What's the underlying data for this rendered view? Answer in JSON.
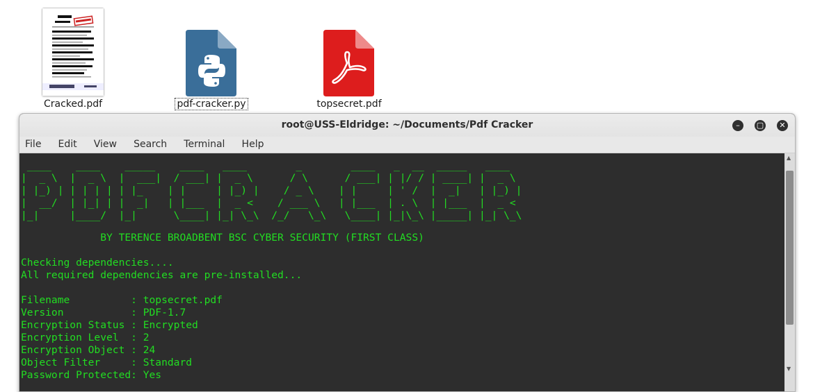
{
  "desktop": {
    "icons": [
      {
        "label": "Cracked.pdf"
      },
      {
        "label": "pdf-cracker.py"
      },
      {
        "label": "topsecret.pdf"
      }
    ]
  },
  "colors": {
    "terminal_bg": "#2d2d2d",
    "terminal_text": "#22dd22",
    "python_file": "#3a6e99",
    "pdf_file": "#dd1d1d"
  },
  "terminal": {
    "title": "root@USS-Eldridge: ~/Documents/Pdf Cracker",
    "menu": [
      "File",
      "Edit",
      "View",
      "Search",
      "Terminal",
      "Help"
    ],
    "banner_lines": [
      " ____    ____    _____    ____   ____        _        ____   _  __  _____   ____",
      "|  _ \\  |  _ \\  |  ___|  / ___| |  _ \\      / \\      / ___| | |/ / | ____| |  _ \\",
      "| |_) | | | | | | |_    | |     | |_) |    / _ \\    | |     | ' /  |  _|   | |_) |",
      "|  __/  | |_| | |  _|   | |___  |  _ <    / ___ \\   | |___  | . \\  | |___  |  _ <",
      "|_|     |____/  |_|      \\____| |_| \\_\\  /_/   \\_\\   \\____| |_|\\_\\ |_____| |_| \\_\\"
    ],
    "byline": "             BY TERENCE BROADBENT BSC CYBER SECURITY (FIRST CLASS)",
    "lines": [
      "Checking dependencies....",
      "All required dependencies are pre-installed...",
      "",
      "Filename          : topsecret.pdf",
      "Version           : PDF-1.7",
      "Encryption Status : Encrypted",
      "Encryption Level  : 2",
      "Encryption Object : 24",
      "Object Filter     : Standard",
      "Password Protected: Yes"
    ]
  }
}
